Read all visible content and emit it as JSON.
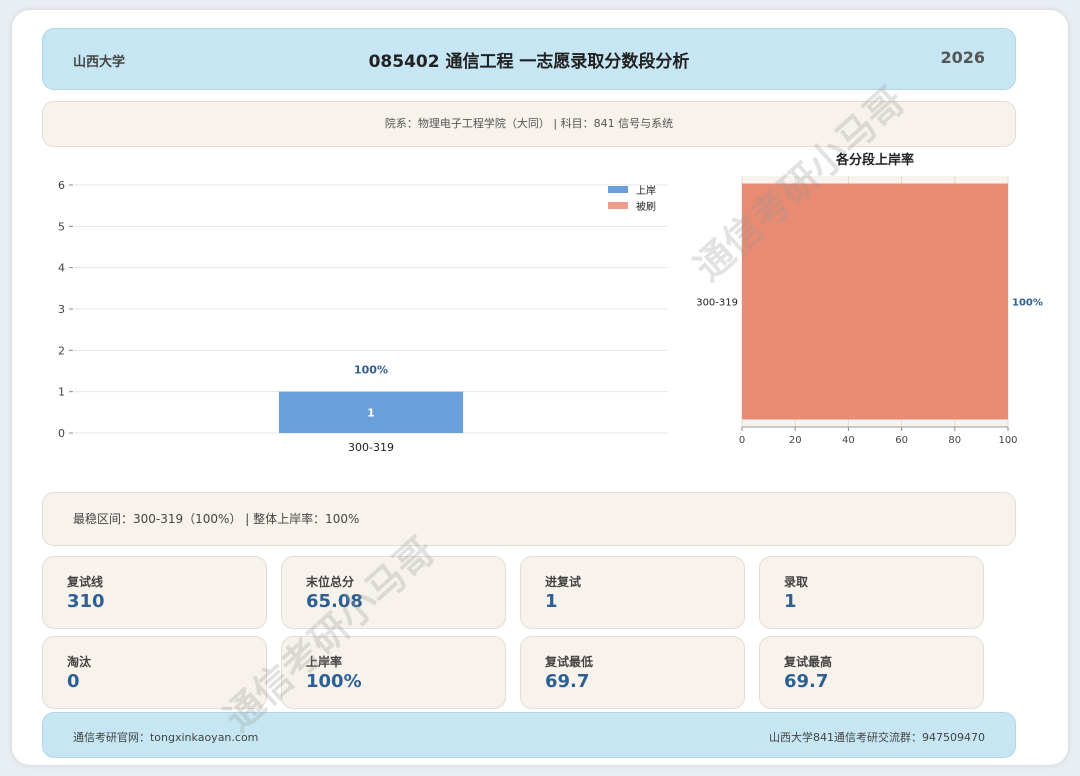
{
  "header": {
    "school": "山西大学",
    "title": "085402 通信工程 一志愿录取分数段分析",
    "year": "2026"
  },
  "info": {
    "text": "院系：物理电子工程学院（大同）  | 科目：841 信号与系统"
  },
  "summary": {
    "text": "最稳区间：300-319（100%）  | 整体上岸率：100%"
  },
  "stats": [
    {
      "label": "复试线",
      "value": "310"
    },
    {
      "label": "末位总分",
      "value": "65.08"
    },
    {
      "label": "进复试",
      "value": "1"
    },
    {
      "label": "录取",
      "value": "1"
    },
    {
      "label": "淘汰",
      "value": "0"
    },
    {
      "label": "上岸率",
      "value": "100%"
    },
    {
      "label": "复试最低",
      "value": "69.7"
    },
    {
      "label": "复试最高",
      "value": "69.7"
    }
  ],
  "footer": {
    "left": "通信考研官网：tongxinkaoyan.com",
    "right": "山西大学841通信考研交流群：947509470"
  },
  "watermark": "通信考研小马哥",
  "colors": {
    "admitted": "#6a9fdd",
    "rejected": "#ee9c8c",
    "rate_bar": "#e98b72",
    "rate_label": "#2e5f93",
    "header_bg": "#c5e6f2",
    "panel_bg": "#f7f3ec"
  },
  "chart_data": [
    {
      "type": "bar",
      "categories": [
        "300-319"
      ],
      "series": [
        {
          "name": "上岸",
          "values": [
            1
          ]
        },
        {
          "name": "被刷",
          "values": [
            0
          ]
        }
      ],
      "stacked": true,
      "data_labels": [
        "1"
      ],
      "rate_labels": [
        "100%"
      ],
      "ylim": [
        0,
        6
      ],
      "yticks": [
        0,
        1,
        2,
        3,
        4,
        5,
        6
      ],
      "legend": "top-right",
      "grid": true
    },
    {
      "type": "bar",
      "orientation": "horizontal",
      "title": "各分段上岸率",
      "categories": [
        "300-319"
      ],
      "values": [
        100
      ],
      "value_labels": [
        "100%"
      ],
      "xlim": [
        0,
        100
      ],
      "xticks": [
        0,
        20,
        40,
        60,
        80,
        100
      ],
      "grid": true
    }
  ]
}
